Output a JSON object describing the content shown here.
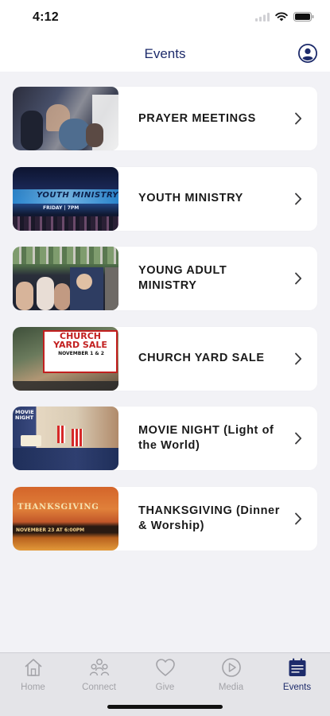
{
  "status": {
    "time": "4:12"
  },
  "nav": {
    "title": "Events",
    "profile_icon": "user-circle-icon"
  },
  "events": [
    {
      "title": "PRAYER MEETINGS"
    },
    {
      "title": "YOUTH MINISTRY",
      "thumb_caption": "YOUTH MINISTRY",
      "thumb_subcaption": "FRIDAY | 7PM"
    },
    {
      "title": "YOUNG ADULT MINISTRY"
    },
    {
      "title": "CHURCH YARD SALE",
      "thumb_caption": "CHURCH YARD SALE",
      "thumb_subcaption": "NOVEMBER 1 & 2"
    },
    {
      "title": "MOVIE NIGHT (Light of the World)",
      "thumb_caption": "MOVIE NIGHT"
    },
    {
      "title": "THANKSGIVING (Dinner & Worship)",
      "thumb_caption": "THANKSGIVING",
      "thumb_subcaption": "NOVEMBER 23 AT 6:00PM"
    }
  ],
  "tabs": [
    {
      "label": "Home",
      "icon": "home-icon"
    },
    {
      "label": "Connect",
      "icon": "people-icon"
    },
    {
      "label": "Give",
      "icon": "heart-icon"
    },
    {
      "label": "Media",
      "icon": "play-circle-icon"
    },
    {
      "label": "Events",
      "icon": "calendar-icon",
      "active": true
    }
  ],
  "colors": {
    "accent": "#1d2b6b",
    "inactive": "#a3a3a8",
    "background": "#f2f2f6"
  }
}
